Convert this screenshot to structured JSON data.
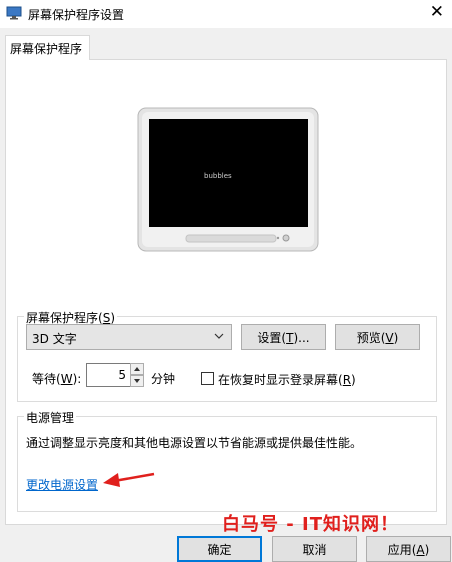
{
  "window": {
    "title": "屏幕保护程序设置",
    "close_glyph": "✕"
  },
  "tabs": [
    {
      "label": "屏幕保护程序"
    }
  ],
  "preview": {
    "screen_text": "bubbles"
  },
  "screensaver_group": {
    "label_text": "屏幕保护程序(",
    "label_key": "S",
    "label_tail": ")",
    "selected": "3D 文字",
    "settings_text": "设置(",
    "settings_key": "T",
    "settings_tail": ")...",
    "preview_text": "预览(",
    "preview_key": "V",
    "preview_tail": ")",
    "wait_text": "等待(",
    "wait_key": "W",
    "wait_tail": "):",
    "wait_value": "5",
    "wait_unit": "分钟",
    "resume_text": "在恢复时显示登录屏幕(",
    "resume_key": "R",
    "resume_tail": ")",
    "resume_checked": false
  },
  "power_group": {
    "label": "电源管理",
    "description": "通过调整显示亮度和其他电源设置以节省能源或提供最佳性能。",
    "link": "更改电源设置"
  },
  "buttons": {
    "ok": "确定",
    "cancel": "取消",
    "apply_text": "应用(",
    "apply_key": "A",
    "apply_tail": ")"
  },
  "watermark": "白马号 - IT知识网！",
  "colors": {
    "link": "#0066cc",
    "arrow": "#e0201d",
    "accent": "#0078d7"
  }
}
